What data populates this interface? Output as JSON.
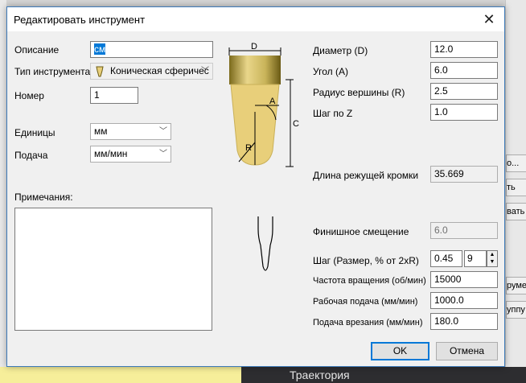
{
  "dialog": {
    "title": "Редактировать инструмент",
    "close_glyph": "✕",
    "ok_label": "OK",
    "cancel_label": "Отмена"
  },
  "left": {
    "description_label": "Описание",
    "description_value": "см",
    "tool_type_label": "Тип инструмента",
    "tool_type_value": "Коническая сферичес",
    "tool_type_icon": "conical-tool-icon",
    "number_label": "Номер",
    "number_value": "1",
    "units_label": "Единицы",
    "units_value": "мм",
    "feed_label": "Подача",
    "feed_value": "мм/мин",
    "notes_label": "Примечания:"
  },
  "diagram": {
    "d": "D",
    "c": "C",
    "a": "A",
    "r": "R"
  },
  "right": {
    "diameter_label": "Диаметр (D)",
    "diameter_value": "12.0",
    "angle_label": "Угол (A)",
    "angle_value": "6.0",
    "tip_radius_label": "Радиус вершины (R)",
    "tip_radius_value": "2.5",
    "stepdown_label": "Шаг по Z",
    "stepdown_value": "1.0",
    "flute_length_label": "Длина режущей кромки",
    "flute_length_value": "35.669",
    "finish_allowance_label": "Финишное смещение",
    "finish_allowance_value": "6.0",
    "stepover_label": "Шаг (Размер, % от 2xR)",
    "stepover_value": "0.45",
    "stepover_percent": "9",
    "spindle_label": "Частота вращения (об/мин)",
    "spindle_value": "15000",
    "feedrate_label": "Рабочая подача (мм/мин)",
    "feedrate_value": "1000.0",
    "plunge_label": "Подача врезания (мм/мин)",
    "plunge_value": "180.0"
  },
  "background": {
    "right_fragments": [
      "о...",
      "ть",
      "вать",
      "руме",
      "уппу"
    ],
    "bottom_text": "Траектория"
  },
  "colors": {
    "tool_gold": "#e8cf7a",
    "tool_gold_dark": "#8a7a2a",
    "selection": "#0078d7",
    "accent_border": "#3c79b8"
  }
}
